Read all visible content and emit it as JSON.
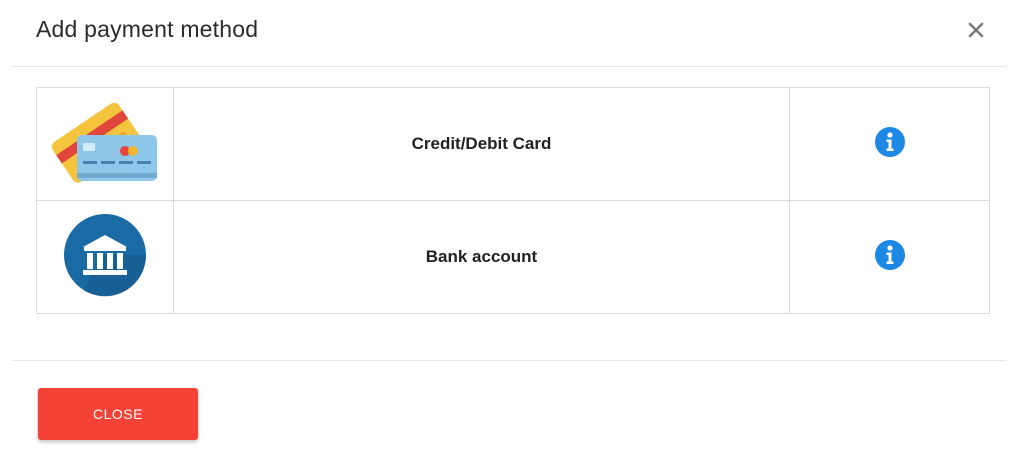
{
  "dialog": {
    "title": "Add payment method",
    "close_icon": "close-x-icon"
  },
  "methods": [
    {
      "label": "Credit/Debit Card",
      "icon": "credit-card-icon",
      "info_icon": "info-icon"
    },
    {
      "label": "Bank account",
      "icon": "bank-icon",
      "info_icon": "info-icon"
    }
  ],
  "footer": {
    "close_label": "CLOSE"
  },
  "colors": {
    "close_button": "#f44336",
    "info_icon": "#1e88e5",
    "bank_circle": "#1a6aa3",
    "border": "#dcdcdc"
  }
}
